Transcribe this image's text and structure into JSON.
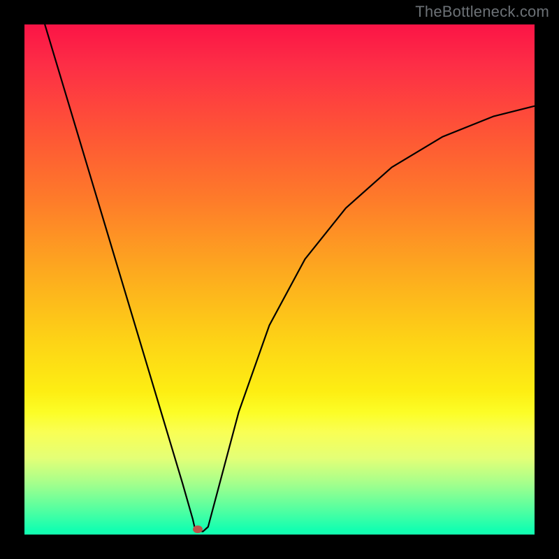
{
  "watermark": {
    "text": "TheBottleneck.com"
  },
  "colors": {
    "frame": "#000000",
    "gradient_top": "#fb1446",
    "gradient_bottom": "#14ffb0",
    "curve_stroke": "#000000",
    "dot_fill": "#bd534b",
    "watermark_color": "#6c7176"
  },
  "chart_data": {
    "type": "line",
    "title": "",
    "xlabel": "",
    "ylabel": "",
    "xlim": [
      0,
      100
    ],
    "ylim": [
      0,
      100
    ],
    "grid": false,
    "legend": false,
    "note": "No axis ticks or labels are rendered; values are estimated proportions of the plot area (0–100 each axis).",
    "series": [
      {
        "name": "curve",
        "points": [
          {
            "x": 4,
            "y": 100
          },
          {
            "x": 10,
            "y": 80
          },
          {
            "x": 16,
            "y": 60
          },
          {
            "x": 22,
            "y": 40
          },
          {
            "x": 28,
            "y": 20
          },
          {
            "x": 31,
            "y": 10
          },
          {
            "x": 33,
            "y": 3
          },
          {
            "x": 33.5,
            "y": 0.8
          },
          {
            "x": 35,
            "y": 0.6
          },
          {
            "x": 36,
            "y": 1.5
          },
          {
            "x": 38,
            "y": 9
          },
          {
            "x": 42,
            "y": 24
          },
          {
            "x": 48,
            "y": 41
          },
          {
            "x": 55,
            "y": 54
          },
          {
            "x": 63,
            "y": 64
          },
          {
            "x": 72,
            "y": 72
          },
          {
            "x": 82,
            "y": 78
          },
          {
            "x": 92,
            "y": 82
          },
          {
            "x": 100,
            "y": 84
          }
        ]
      }
    ],
    "marker": {
      "name": "minimum-dot",
      "x": 34,
      "y": 0.5
    }
  }
}
